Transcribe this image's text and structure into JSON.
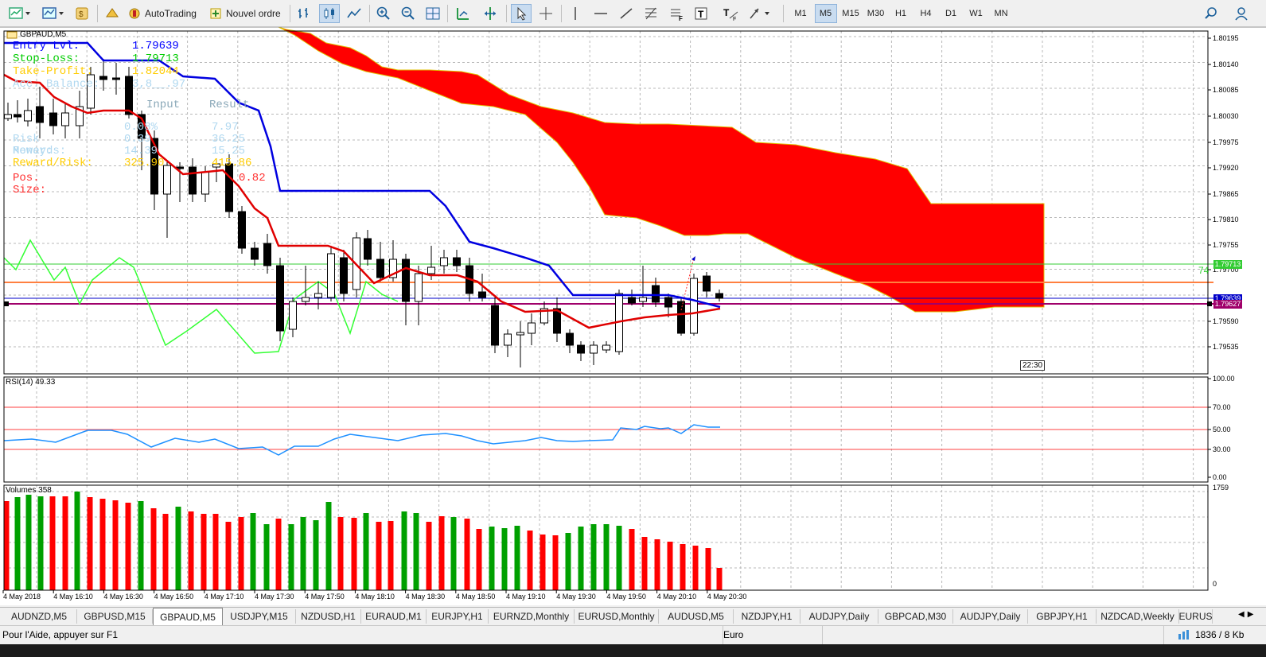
{
  "toolbar": {
    "autotrading_label": "AutoTrading",
    "new_order_label": "Nouvel ordre",
    "timeframes": [
      "M1",
      "M5",
      "M15",
      "M30",
      "H1",
      "H4",
      "D1",
      "W1",
      "MN"
    ],
    "active_timeframe": "M5"
  },
  "chart": {
    "symbol_label": "GBPAUD,M5",
    "price_axis": [
      "1.80195",
      "1.80140",
      "1.80085",
      "1.80030",
      "1.79975",
      "1.79920",
      "1.79865",
      "1.79810",
      "1.79755",
      "1.79700",
      "1.79590",
      "1.79535"
    ],
    "tp_tag": "1.79713",
    "entry_tag": "1.79639",
    "sl_tag": "1.79627",
    "level_value": "74",
    "time_marker": "22:30",
    "time_axis": [
      "4 May 2018",
      "4 May 16:10",
      "4 May 16:30",
      "4 May 16:50",
      "4 May 17:10",
      "4 May 17:30",
      "4 May 17:50",
      "4 May 18:10",
      "4 May 18:30",
      "4 May 18:50",
      "4 May 19:10",
      "4 May 19:30",
      "4 May 19:50",
      "4 May 20:10",
      "4 May 20:30"
    ]
  },
  "panel": {
    "entry_label": "Entry Lvl:",
    "entry_value": "1.79639",
    "sl_label": "Stop-Loss:",
    "sl_value": "1.79713",
    "tp_label": "Take-Profit:",
    "tp_value": "1.82044",
    "bal_label": "Acc. Balance:",
    "bal_value": "3,8__.97",
    "input_header": "Input",
    "result_header": "Result",
    "rows": [
      {
        "label": "",
        "input": "0.08%",
        "result": "7.97"
      },
      {
        "label": "Risk Money:",
        "input": "0.39",
        "result": "36.25"
      },
      {
        "label": "Rewards:",
        "input": "14.39",
        "result": "15.25"
      },
      {
        "label": "Reward/Risk:",
        "input": "325.90",
        "result": "415.86"
      }
    ],
    "pos_label": "Pos. Size:",
    "pos_value": "0.82"
  },
  "rsi": {
    "label": "RSI(14) 49.33",
    "axis": [
      "100.00",
      "70.00",
      "50.00",
      "30.00",
      "0.00"
    ]
  },
  "volumes": {
    "label": "Volumes 358",
    "axis_top": "1759",
    "axis_bottom": "0"
  },
  "tabs": [
    "AUDNZD,M5",
    "GBPUSD,M15",
    "GBPAUD,M5",
    "USDJPY,M15",
    "NZDUSD,H1",
    "EURAUD,M1",
    "EURJPY,H1",
    "EURNZD,Monthly",
    "EURUSD,Monthly",
    "AUDUSD,M5",
    "NZDJPY,H1",
    "AUDJPY,Daily",
    "GBPCAD,M30",
    "AUDJPY,Daily",
    "GBPJPY,H1",
    "NZDCAD,Weekly",
    "EURUS"
  ],
  "active_tab": "GBPAUD,M5",
  "status": {
    "help_text": "Pour l'Aide, appuyer sur F1",
    "profile": "Euro",
    "connection": "1836 / 8 Kb"
  },
  "colors": {
    "cloud": "#ff0000",
    "blue_line": "#0000e0",
    "red_line": "#e00000",
    "green_line": "#33ff33",
    "rsi_line": "#1e90ff",
    "orange_level": "#ff8040",
    "magenta_level": "#a0006a",
    "vol_up": "#00a000",
    "vol_down": "#ff0000"
  }
}
